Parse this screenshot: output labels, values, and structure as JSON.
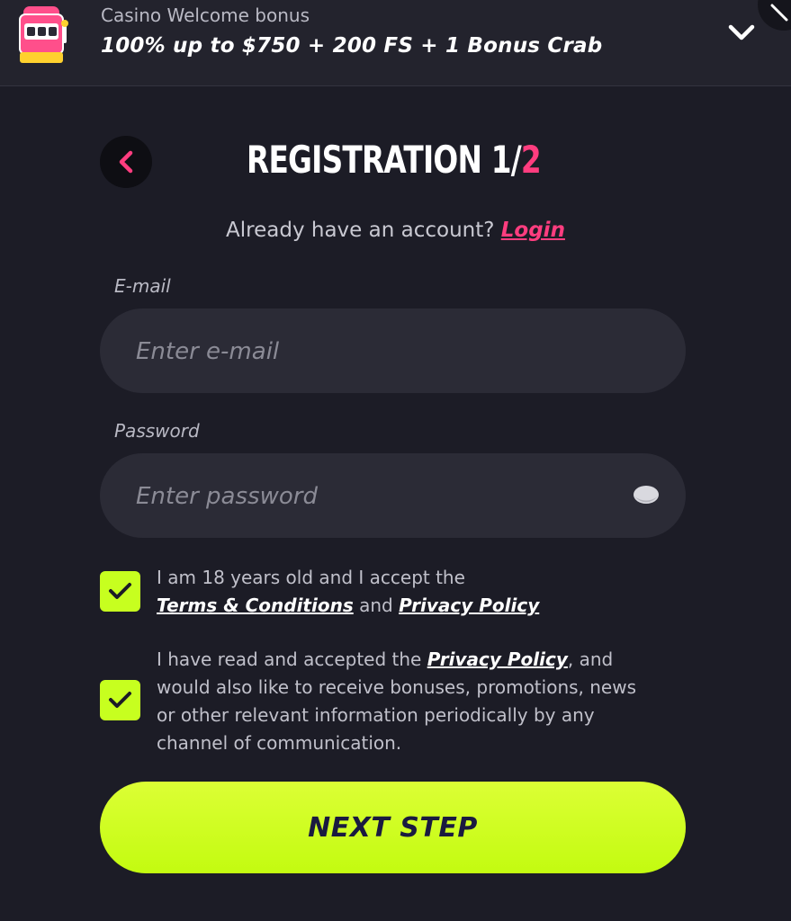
{
  "banner": {
    "subtitle": "Casino Welcome bonus",
    "title": "100% up to $750 + 200 FS + 1 Bonus Crab",
    "icon": "slot-machine-icon"
  },
  "header": {
    "title_main": "REGISTRATION 1/",
    "title_total": "2"
  },
  "account": {
    "prompt": "Already have an account?",
    "login_label": "Login"
  },
  "email": {
    "label": "E-mail",
    "placeholder": "Enter e-mail",
    "value": ""
  },
  "password": {
    "label": "Password",
    "placeholder": "Enter password",
    "value": ""
  },
  "consents": [
    {
      "checked": true,
      "text_1": "I am 18 years old and I accept the",
      "link_1": "Terms & Conditions",
      "text_2": "and",
      "link_2": "Privacy Policy"
    },
    {
      "checked": true,
      "text_1": "I have read and accepted the",
      "link_1": "Privacy Policy",
      "text_2": ", and",
      "line_2": "would also like to receive bonuses, promotions, news",
      "line_3": "or other relevant information periodically by any",
      "line_4": "channel of communication."
    }
  ],
  "actions": {
    "next_label": "NEXT STEP"
  },
  "colors": {
    "background": "#1c1c26",
    "accent_pink": "#ff3d7f",
    "accent_lime": "#c7ff1f",
    "field_bg": "#2b2b36",
    "button_text": "#1a1a40"
  }
}
